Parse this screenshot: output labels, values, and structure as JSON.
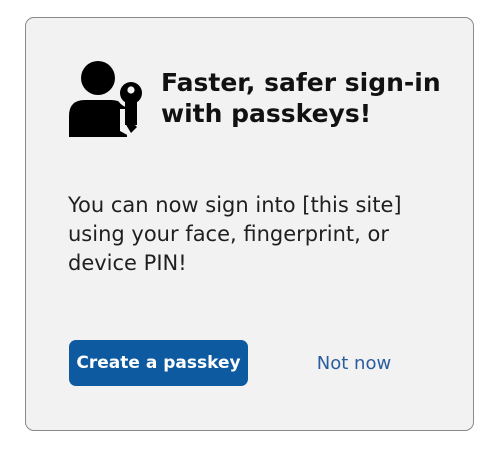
{
  "dialog": {
    "title": "Faster, safer sign-in with passkeys!",
    "message": "You can now sign into [this site] using your face, fingerprint, or device PIN!",
    "icon": "person-key-icon",
    "primary_button": "Create a passkey",
    "secondary_button": "Not now"
  },
  "colors": {
    "card_background": "#f2f2f2",
    "card_border": "#8a8a8a",
    "primary_button": "#0d5aa0",
    "link": "#2a5d9e"
  }
}
